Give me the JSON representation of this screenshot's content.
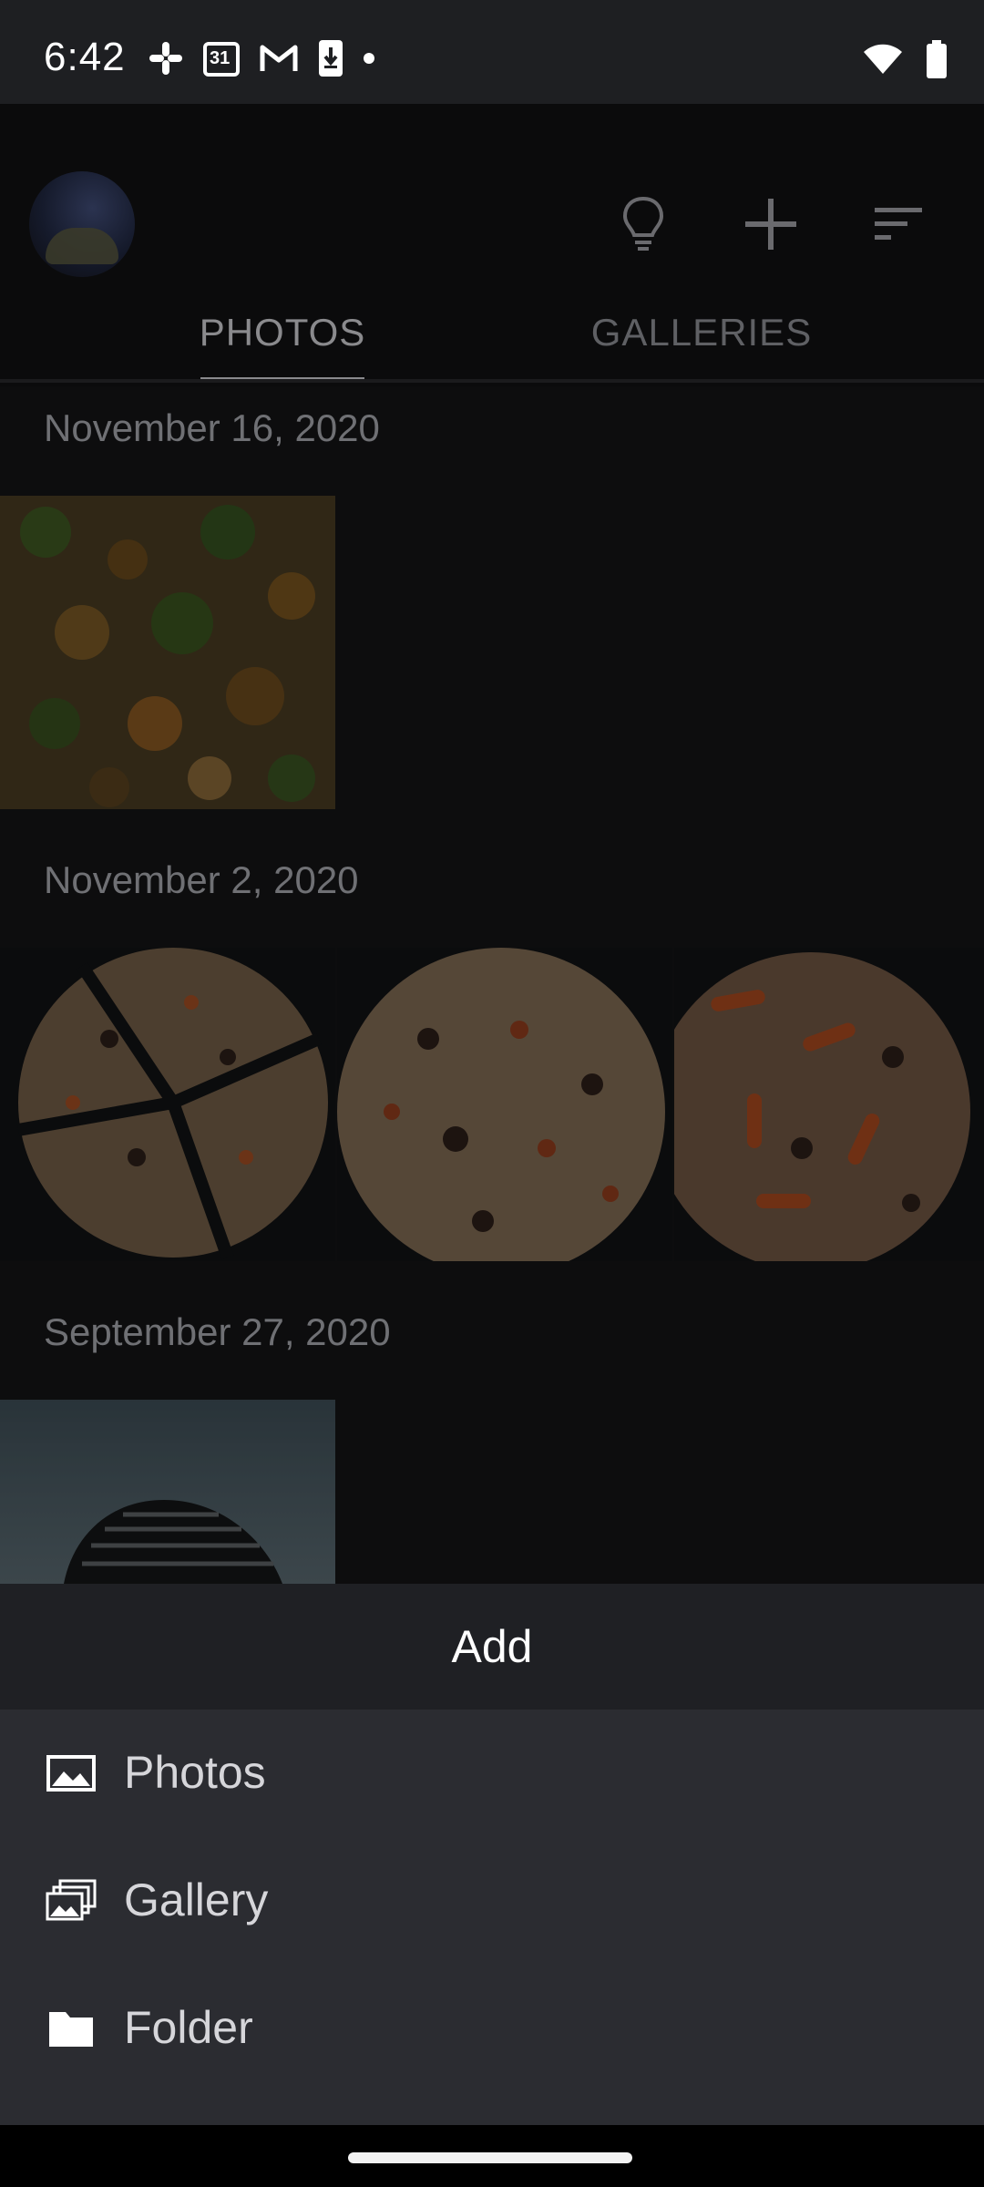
{
  "status_bar": {
    "time": "6:42",
    "calendar_day": "31",
    "icons": [
      "slack-icon",
      "calendar-icon",
      "gmail-icon",
      "download-icon",
      "dot-icon",
      "wifi-icon",
      "battery-icon"
    ]
  },
  "header": {
    "avatar_icon": "avatar",
    "actions": [
      "lightbulb-icon",
      "plus-icon",
      "sort-icon"
    ]
  },
  "tabs": [
    {
      "label": "PHOTOS",
      "selected": true
    },
    {
      "label": "GALLERIES",
      "selected": false
    }
  ],
  "sections": [
    {
      "date": "November 16, 2020",
      "photos": [
        "salad-photo"
      ]
    },
    {
      "date": "November 2, 2020",
      "photos": [
        "pizza-slices-photo",
        "pizza-photo",
        "pizza-peppers-photo"
      ]
    },
    {
      "date": "September 27, 2020",
      "photos": [
        "tower-photo"
      ]
    }
  ],
  "sheet": {
    "title": "Add",
    "options": [
      {
        "label": "Photos",
        "icon": "image-icon"
      },
      {
        "label": "Gallery",
        "icon": "gallery-icon"
      },
      {
        "label": "Folder",
        "icon": "folder-icon"
      }
    ]
  },
  "colors": {
    "status_bar_bg": "#1e1f22",
    "background": "#0d0d0e",
    "sheet_title_bg": "#1f2024",
    "sheet_bg": "#2b2c31"
  }
}
